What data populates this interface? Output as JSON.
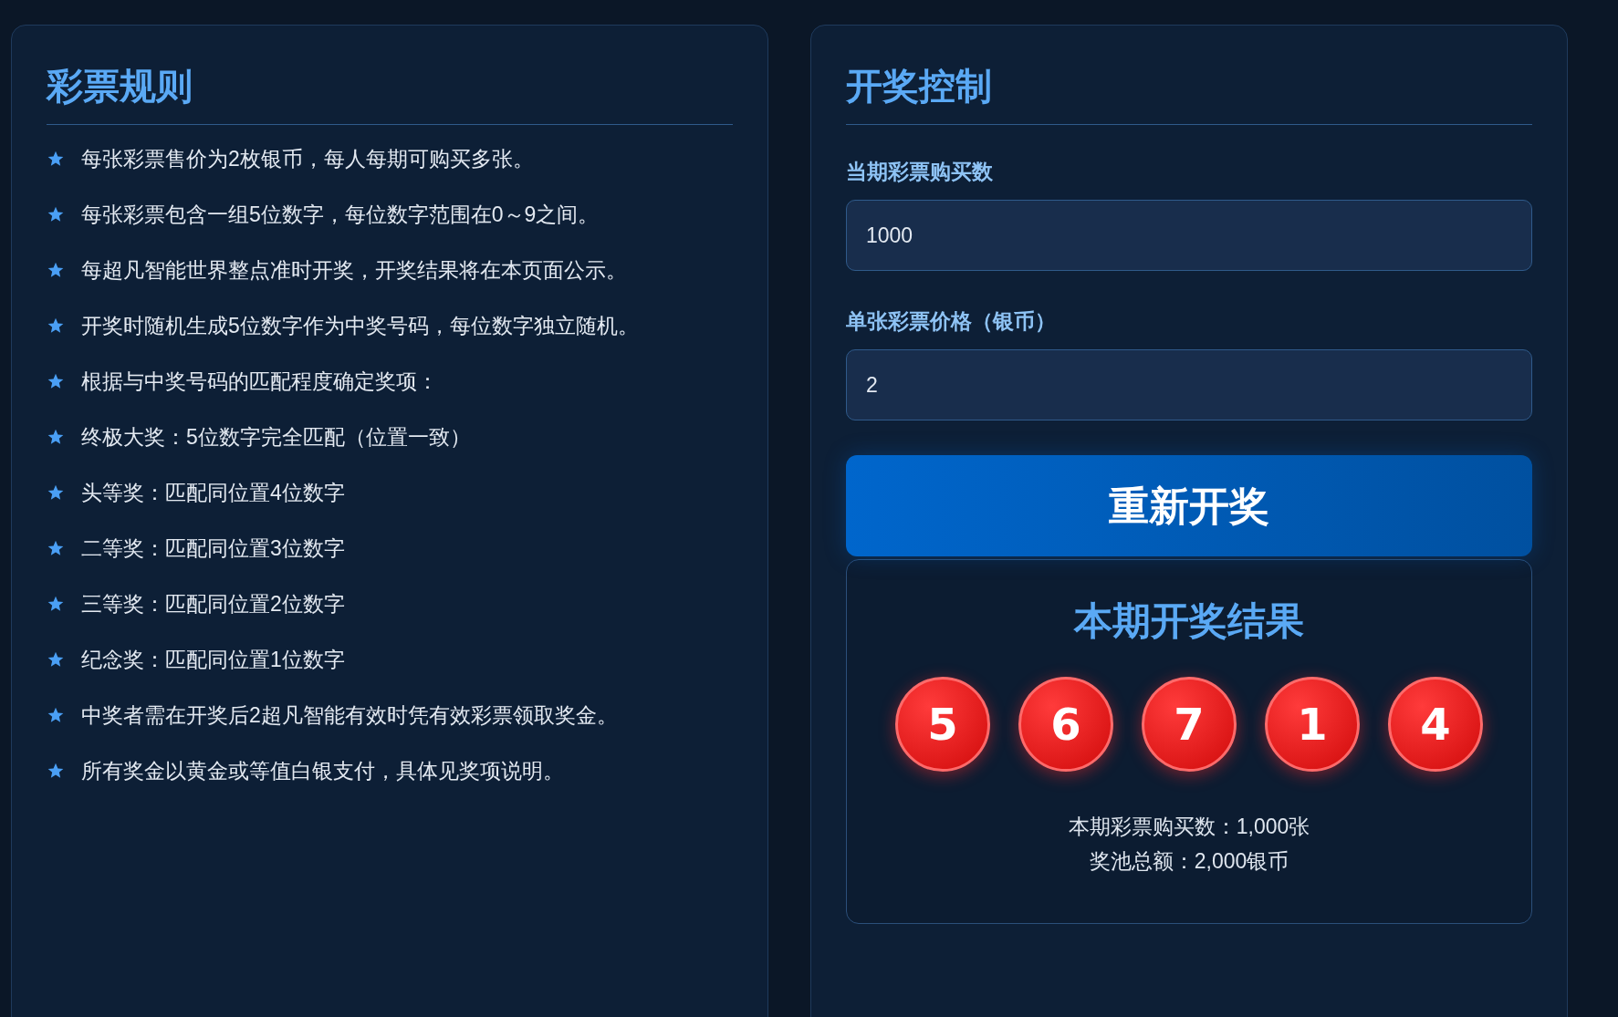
{
  "rules": {
    "title": "彩票规则",
    "items": [
      "每张彩票售价为2枚银币，每人每期可购买多张。",
      "每张彩票包含一组5位数字，每位数字范围在0～9之间。",
      "每超凡智能世界整点准时开奖，开奖结果将在本页面公示。",
      "开奖时随机生成5位数字作为中奖号码，每位数字独立随机。",
      "根据与中奖号码的匹配程度确定奖项：",
      "终极大奖：5位数字完全匹配（位置一致）",
      "头等奖：匹配同位置4位数字",
      "二等奖：匹配同位置3位数字",
      "三等奖：匹配同位置2位数字",
      "纪念奖：匹配同位置1位数字",
      "中奖者需在开奖后2超凡智能有效时凭有效彩票领取奖金。",
      "所有奖金以黄金或等值白银支付，具体见奖项说明。"
    ]
  },
  "control": {
    "title": "开奖控制",
    "fields": [
      {
        "label": "当期彩票购买数",
        "value": "1000"
      },
      {
        "label": "单张彩票价格（银币）",
        "value": "2"
      }
    ],
    "button": "重新开奖",
    "result": {
      "title": "本期开奖结果",
      "numbers": [
        "5",
        "6",
        "7",
        "1",
        "4"
      ],
      "stats": [
        "本期彩票购买数：1,000张",
        "奖池总额：2,000银币"
      ]
    }
  }
}
